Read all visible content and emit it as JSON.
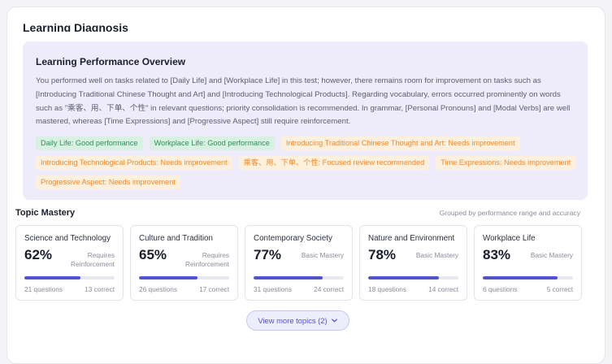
{
  "page": {
    "title": "Learning Diagnosis"
  },
  "overview": {
    "title": "Learning Performance Overview",
    "text": "You performed well on tasks related to [Daily Life] and [Workplace Life] in this test; however, there remains room for improvement on tasks such as [Introducing Traditional Chinese Thought and Art] and [Introducing Technological Products]. Regarding vocabulary, errors occurred prominently on words such as \"乘客、用、下单、个性\" in relevant questions; priority consolidation is recommended. In grammar, [Personal Pronouns] and [Modal Verbs] are well mastered, whereas [Time Expressions] and [Progressive Aspect] still require reinforcement.",
    "tags": [
      {
        "label": "Daily Life: Good performance",
        "status": "good"
      },
      {
        "label": "Workplace Life: Good performance",
        "status": "good"
      },
      {
        "label": "Introducing Traditional Chinese Thought and Art: Needs improvement",
        "status": "warn"
      },
      {
        "label": "Introducing Technological Products: Needs improvement",
        "status": "warn"
      },
      {
        "label": "乘客、用、下单、个性: Focused review recommended",
        "status": "warn"
      },
      {
        "label": "Time Expressions: Needs improvement",
        "status": "warn"
      },
      {
        "label": "Progressive Aspect: Needs improvement",
        "status": "warn"
      }
    ]
  },
  "topics_section": {
    "title": "Topic Mastery",
    "subtitle": "Grouped by performance range and accuracy",
    "items": [
      {
        "name": "Science and Technology",
        "percent": "62%",
        "progress": 0.62,
        "level": "Requires Reinforcement",
        "questions": "21 questions",
        "correct": "13 correct"
      },
      {
        "name": "Culture and Tradition",
        "percent": "65%",
        "progress": 0.65,
        "level": "Requires Reinforcement",
        "questions": "26 questions",
        "correct": "17 correct"
      },
      {
        "name": "Contemporary Society",
        "percent": "77%",
        "progress": 0.77,
        "level": "Basic Mastery",
        "questions": "31 questions",
        "correct": "24 correct"
      },
      {
        "name": "Nature and Environment",
        "percent": "78%",
        "progress": 0.78,
        "level": "Basic Mastery",
        "questions": "18 questions",
        "correct": "14 correct"
      },
      {
        "name": "Workplace Life",
        "percent": "83%",
        "progress": 0.83,
        "level": "Basic Mastery",
        "questions": "6 questions",
        "correct": "5 correct"
      }
    ]
  },
  "more_button": {
    "label": "View more topics (2)",
    "icon": "chevron-down-icon"
  },
  "colors": {
    "accent": "#5054cf",
    "good": "#2e8f57",
    "warn": "#ef8a29",
    "panel": "#eeecfb"
  }
}
